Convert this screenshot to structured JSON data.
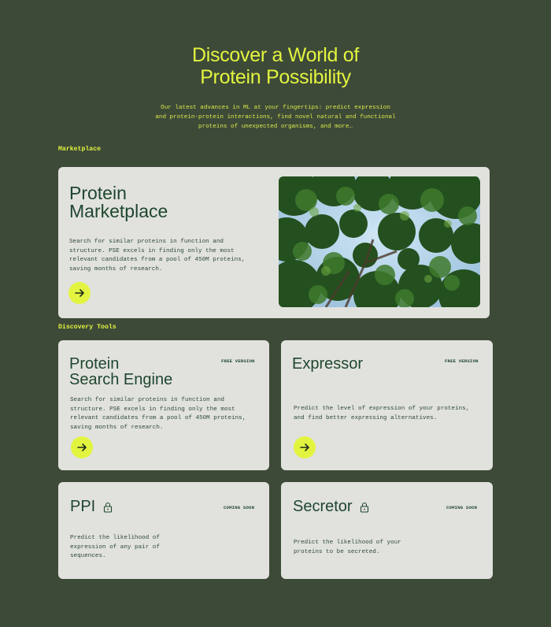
{
  "hero": {
    "title_line1": "Discover a World of",
    "title_line2": "Protein Possibility",
    "subtitle_line1": "Our latest advances in ML at your fingertips: predict expression",
    "subtitle_line2": "and protein-protein interactions, find novel natural and functional",
    "subtitle_line3": "proteins of unexpected organisms, and more…"
  },
  "sections": {
    "marketplace_label": "Marketplace",
    "discovery_label": "Discovery Tools"
  },
  "marketplace_card": {
    "title_line1": "Protein",
    "title_line2": "Marketplace",
    "desc_line1": "Search for similar proteins in function and",
    "desc_line2": "structure. PSE excels in finding only the most",
    "desc_line3": "relevant candidates from a pool of 450M proteins,",
    "desc_line4": "saving months of research.",
    "image": "tree-canopy-photo"
  },
  "tools": [
    {
      "title_line1": "Protein",
      "title_line2": "Search Engine",
      "badge": "FREE VERSION",
      "desc_line1": "Search for similar proteins in function and",
      "desc_line2": "structure. PSE excels in finding only the most",
      "desc_line3": "relevant candidates from a pool of 450M proteins,",
      "desc_line4": "saving months of research."
    },
    {
      "title_line1": "Expressor",
      "badge": "FREE VERSION",
      "desc_line1": "Predict the level of expression of your proteins,",
      "desc_line2": "and find better expressing alternatives."
    },
    {
      "title_line1": "PPI",
      "badge": "COMING SOON",
      "desc_line1": "Predict the likelihood of",
      "desc_line2": "expression of any pair of",
      "desc_line3": "sequences."
    },
    {
      "title_line1": "Secretor",
      "badge": "COMING SOON",
      "desc_line1": "Predict the likelihood of your",
      "desc_line2": "proteins to be secreted."
    }
  ],
  "colors": {
    "background": "#3e4a38",
    "accent": "#e2f43f",
    "card": "#e1e2dd",
    "title_text": "#1f4630"
  },
  "icons": {
    "arrow": "arrow-right-icon",
    "lock": "lock-icon"
  }
}
